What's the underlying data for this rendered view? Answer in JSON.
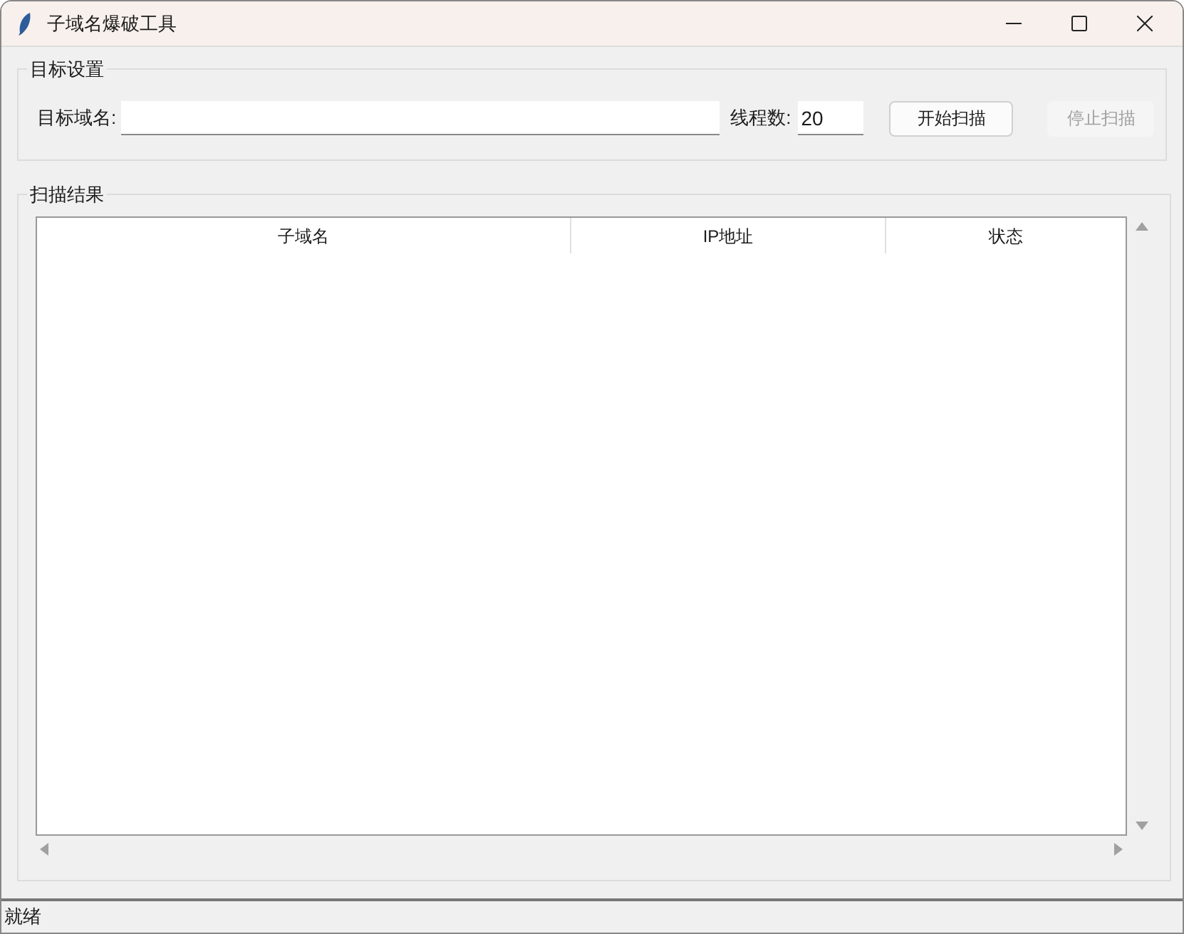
{
  "window": {
    "title": "子域名爆破工具"
  },
  "target_group": {
    "title": "目标设置",
    "domain_label": "目标域名:",
    "threads_label": "线程数:",
    "threads_value": "20",
    "buttons": [
      {
        "label": "开始扫描",
        "disabled": false
      },
      {
        "label": "停止扫描",
        "disabled": true
      }
    ]
  },
  "results_group": {
    "title": "扫描结果",
    "table": {
      "columns": [
        "子域名",
        "IP地址",
        "状态"
      ]
    }
  },
  "status_bar": "就绪"
}
